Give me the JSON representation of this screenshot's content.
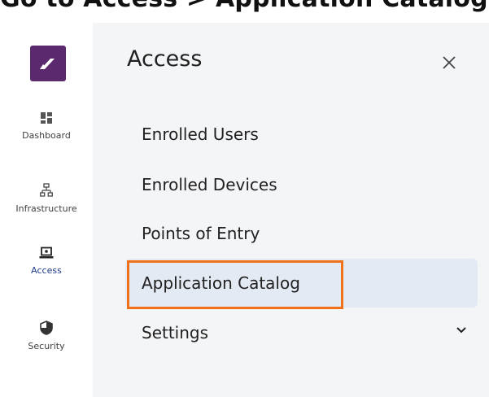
{
  "banner": {
    "text": "Go to Access > Application Catalog"
  },
  "rail": {
    "items": [
      {
        "label": "Dashboard",
        "icon": "dashboard-icon"
      },
      {
        "label": "Infrastructure",
        "icon": "network-icon"
      },
      {
        "label": "Access",
        "icon": "laptop-icon"
      },
      {
        "label": "Security",
        "icon": "shield-icon"
      }
    ],
    "active": "Access"
  },
  "panel": {
    "title": "Access",
    "close_icon": "close-icon",
    "items": [
      {
        "label": "Enrolled Users"
      },
      {
        "label": "Enrolled Devices"
      },
      {
        "label": "Points of Entry"
      },
      {
        "label": "Application Catalog"
      },
      {
        "label": "Settings",
        "icon": "chevron-down-icon"
      }
    ],
    "selected": "Application Catalog"
  },
  "colors": {
    "brand": "#5b2a6e",
    "highlight": "#f07118",
    "selected_bg": "#e4eaf3",
    "panel_bg": "#f4f5f7"
  }
}
